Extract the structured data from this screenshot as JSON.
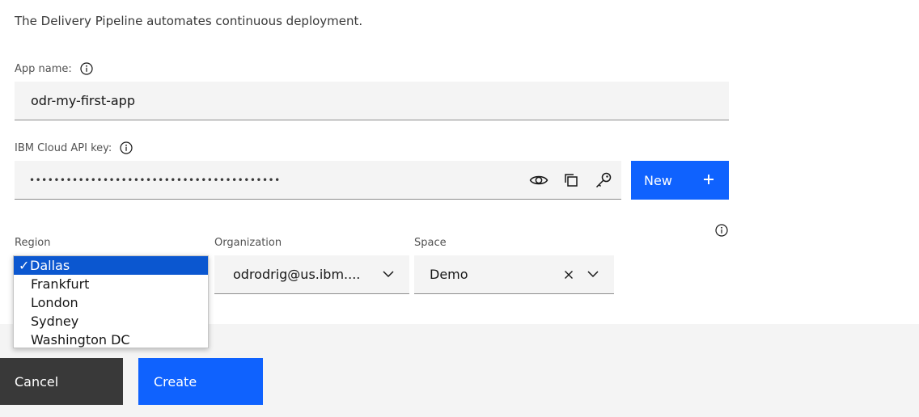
{
  "intro_text": "The Delivery Pipeline automates continuous deployment.",
  "app_name": {
    "label": "App name:",
    "value": "odr-my-first-app"
  },
  "api_key": {
    "label": "IBM Cloud API key:",
    "value": "•••••••••••••••••••••••••••••••••••••••••",
    "new_button_label": "New",
    "new_button_icon": "+"
  },
  "region": {
    "label": "Region",
    "selected": "Dallas",
    "options": [
      "Dallas",
      "Frankfurt",
      "London",
      "Sydney",
      "Washington DC"
    ],
    "check_mark": "✓"
  },
  "organization": {
    "label": "Organization",
    "value": "odrodrig@us.ibm...."
  },
  "space": {
    "label": "Space",
    "value": "Demo"
  },
  "footer": {
    "cancel_label": "Cancel",
    "create_label": "Create"
  },
  "colors": {
    "primary": "#0f62fe",
    "secondary": "#393939",
    "field_bg": "#f4f4f4",
    "dropdown_selected": "#0b57d0"
  }
}
